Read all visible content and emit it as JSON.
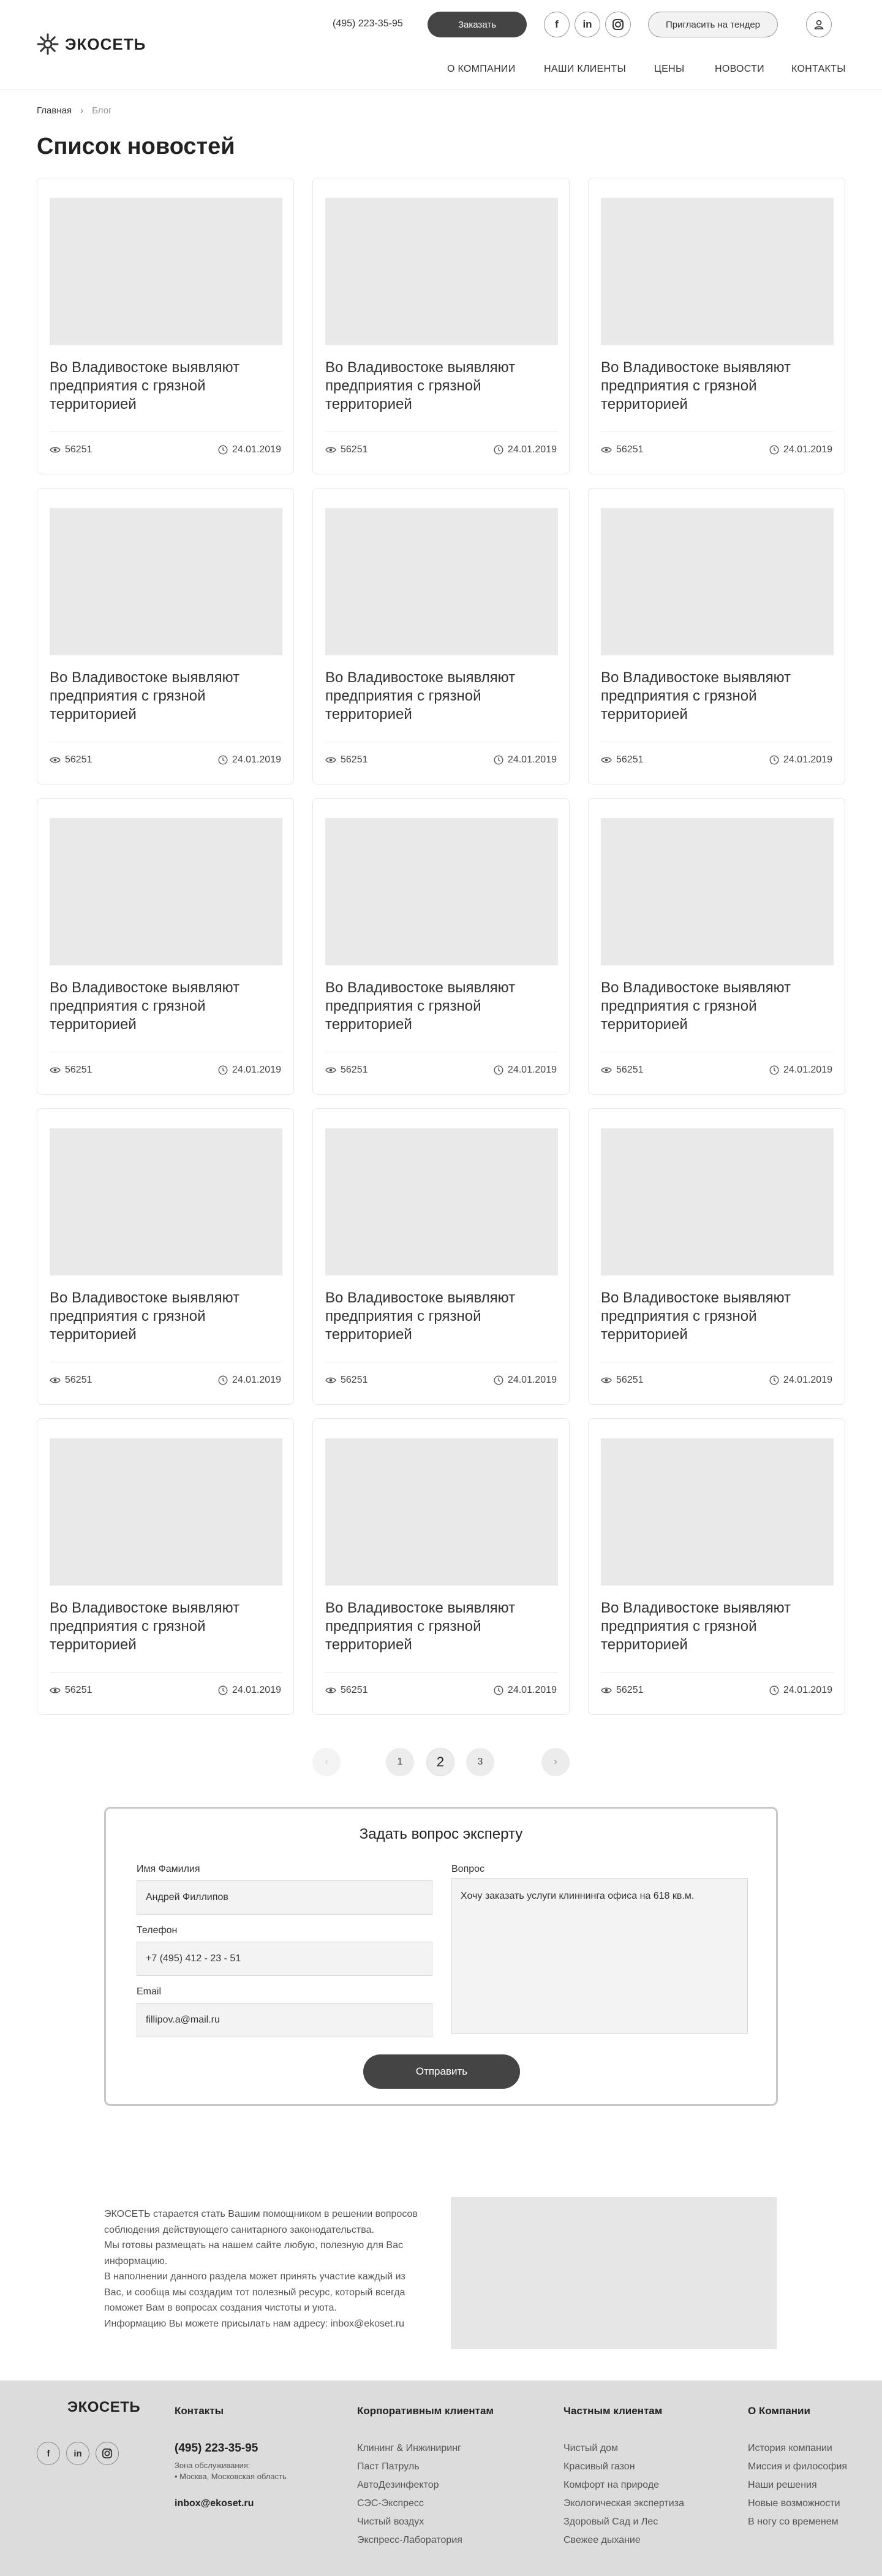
{
  "header": {
    "logo_text": "ЭКОСЕТЬ",
    "phone": "(495) 223-35-95",
    "order_label": "Заказать",
    "social": [
      "f",
      "in",
      "ig"
    ],
    "tender_label": "Пригласить на тендер",
    "nav": [
      "О КОМПАНИИ",
      "НАШИ КЛИЕНТЫ",
      "ЦЕНЫ",
      "НОВОСТИ",
      "КОНТАКТЫ"
    ]
  },
  "breadcrumb": {
    "home": "Главная",
    "current": "Блог"
  },
  "page_title": "Список новостей",
  "cards": [
    {
      "title": "Во Владивостоке выявляют предприятия с грязной территорией",
      "views": "56251",
      "date": "24.01.2019"
    },
    {
      "title": "Во Владивостоке выявляют предприятия с грязной территорией",
      "views": "56251",
      "date": "24.01.2019"
    },
    {
      "title": "Во Владивостоке выявляют предприятия с грязной территорией",
      "views": "56251",
      "date": "24.01.2019"
    },
    {
      "title": "Во Владивостоке выявляют предприятия с грязной территорией",
      "views": "56251",
      "date": "24.01.2019"
    },
    {
      "title": "Во Владивостоке выявляют предприятия с грязной территорией",
      "views": "56251",
      "date": "24.01.2019"
    },
    {
      "title": "Во Владивостоке выявляют предприятия с грязной территорией",
      "views": "56251",
      "date": "24.01.2019"
    },
    {
      "title": "Во Владивостоке выявляют предприятия с грязной территорией",
      "views": "56251",
      "date": "24.01.2019"
    },
    {
      "title": "Во Владивостоке выявляют предприятия с грязной территорией",
      "views": "56251",
      "date": "24.01.2019"
    },
    {
      "title": "Во Владивостоке выявляют предприятия с грязной территорией",
      "views": "56251",
      "date": "24.01.2019"
    },
    {
      "title": "Во Владивостоке выявляют предприятия с грязной территорией",
      "views": "56251",
      "date": "24.01.2019"
    },
    {
      "title": "Во Владивостоке выявляют предприятия с грязной территорией",
      "views": "56251",
      "date": "24.01.2019"
    },
    {
      "title": "Во Владивостоке выявляют предприятия с грязной территорией",
      "views": "56251",
      "date": "24.01.2019"
    },
    {
      "title": "Во Владивостоке выявляют предприятия с грязной территорией",
      "views": "56251",
      "date": "24.01.2019"
    },
    {
      "title": "Во Владивостоке выявляют предприятия с грязной территорией",
      "views": "56251",
      "date": "24.01.2019"
    },
    {
      "title": "Во Владивостоке выявляют предприятия с грязной территорией",
      "views": "56251",
      "date": "24.01.2019"
    }
  ],
  "pagination": {
    "pages": [
      "1",
      "2",
      "3"
    ],
    "active": "2"
  },
  "form": {
    "title": "Задать вопрос эксперту",
    "name_label": "Имя Фамилия",
    "name_value": "Андрей Филлипов",
    "phone_label": "Телефон",
    "phone_value": "+7 (495) 412 - 23 - 51",
    "email_label": "Email",
    "email_value": "fillipov.a@mail.ru",
    "question_label": "Вопрос",
    "question_value": "Хочу заказать услуги клиннинга офиса на 618 кв.м.",
    "submit_label": "Отправить"
  },
  "about": {
    "paragraphs": [
      "ЭКОСЕТЬ старается стать Вашим помощником в решении вопросов соблюдения действующего санитарного законодательства.",
      "Мы готовы размещать на нашем сайте любую, полезную для Вас информацию.",
      "В наполнении данного раздела может принять участие каждый из Вас, и сообща мы создадим тот полезный ресурс, который всегда поможет Вам в вопросах создания чистоты и уюта.",
      "Информацию Вы можете присылать нам адресу: inbox@ekoset.ru"
    ]
  },
  "footer": {
    "logo_text": "ЭКОСЕТЬ",
    "social": [
      "f",
      "in",
      "ig"
    ],
    "contacts_title": "Контакты",
    "phone": "(495) 223-35-95",
    "zone_label": "Зона обслуживания:",
    "zone_value": "• Москва, Московская область",
    "email": "inbox@ekoset.ru",
    "corporate_title": "Корпоративным клиентам",
    "corporate_links": [
      "Клининг & Инжиниринг",
      "Паст Патруль",
      "АвтоДезинфектор",
      "СЭС-Экспресс",
      "Чистый воздух",
      "Экспресс-Лаборатория"
    ],
    "private_title": "Частным клиентам",
    "private_links": [
      "Чистый дом",
      "Красивый газон",
      "Комфорт на природе",
      "Экологическая экспертиза",
      "Здоровый Сад и Лес",
      "Свежее дыхание"
    ],
    "company_title": "О Компании",
    "company_links": [
      "История компании",
      "Миссия и философия",
      "Наши решения",
      "Новые возможности",
      "В ногу со временем"
    ]
  }
}
